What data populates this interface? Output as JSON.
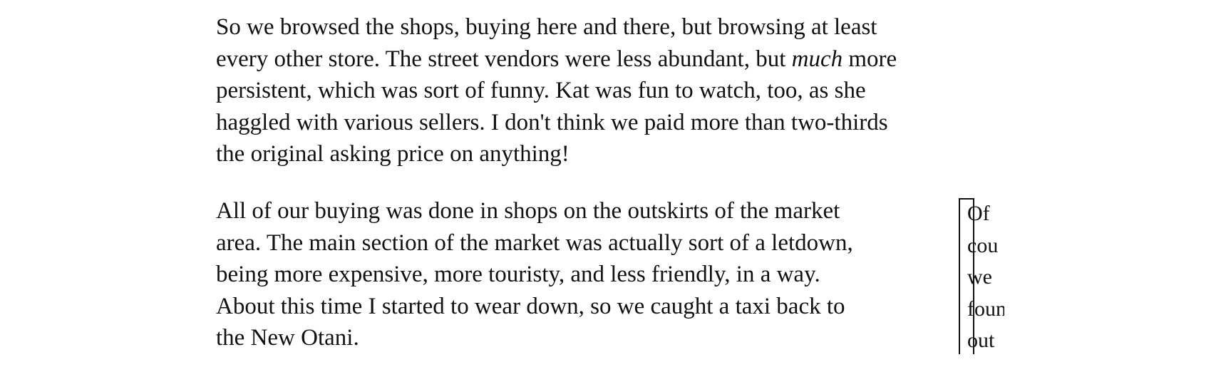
{
  "paragraph_1": {
    "line_1": "So we browsed the shops, buying here and there, but browsing at least",
    "line_2_before": "every other store. The street vendors were less abundant, but ",
    "line_2_emphasis": "much",
    "line_2_after": " more",
    "line_3": "persistent, which was sort of funny. Kat was fun to watch, too, as she",
    "line_4": "haggled with various sellers. I don't think we paid more than two-thirds",
    "line_5": "the original asking price on anything!"
  },
  "paragraph_2": {
    "lines": [
      "All of our buying was done in shops on the outskirts of the market",
      "area. The main section of the market was actually sort of a letdown,",
      "being more expensive, more touristy, and less friendly, in a way.",
      "About this time I started to wear down, so we caught a taxi back to",
      "the New Otani."
    ]
  },
  "sidenote": {
    "lines": [
      "Of",
      "cou",
      "we",
      "foun",
      "out"
    ]
  }
}
